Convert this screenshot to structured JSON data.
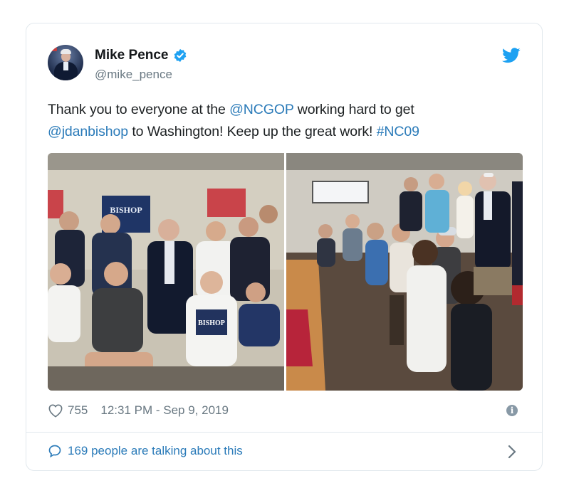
{
  "tweet": {
    "author_name": "Mike Pence",
    "author_handle": "@mike_pence",
    "text_parts": {
      "p1": "Thank you to everyone at the ",
      "mention1": "@NCGOP",
      "p2": " working hard to get",
      "mention2": "@jdanbishop",
      "p3": " to Washington! Keep up the great work! ",
      "hashtag": "#NC09"
    },
    "photo_left_signs": [
      "BISHOP"
    ],
    "photo_shirt_text": "BISHOP"
  },
  "footer": {
    "likes": "755",
    "timestamp": "12:31 PM - Sep 9, 2019",
    "talking_label": "169 people are talking about this"
  },
  "colors": {
    "link": "#2b7bb9",
    "verified": "#1da1f2",
    "secondary": "#697882"
  },
  "icons": {
    "verified": "verified-badge-icon",
    "bird": "twitter-bird-icon",
    "heart": "heart-icon",
    "info": "info-icon",
    "bubble": "speech-bubble-icon",
    "chevron": "chevron-right-icon"
  }
}
